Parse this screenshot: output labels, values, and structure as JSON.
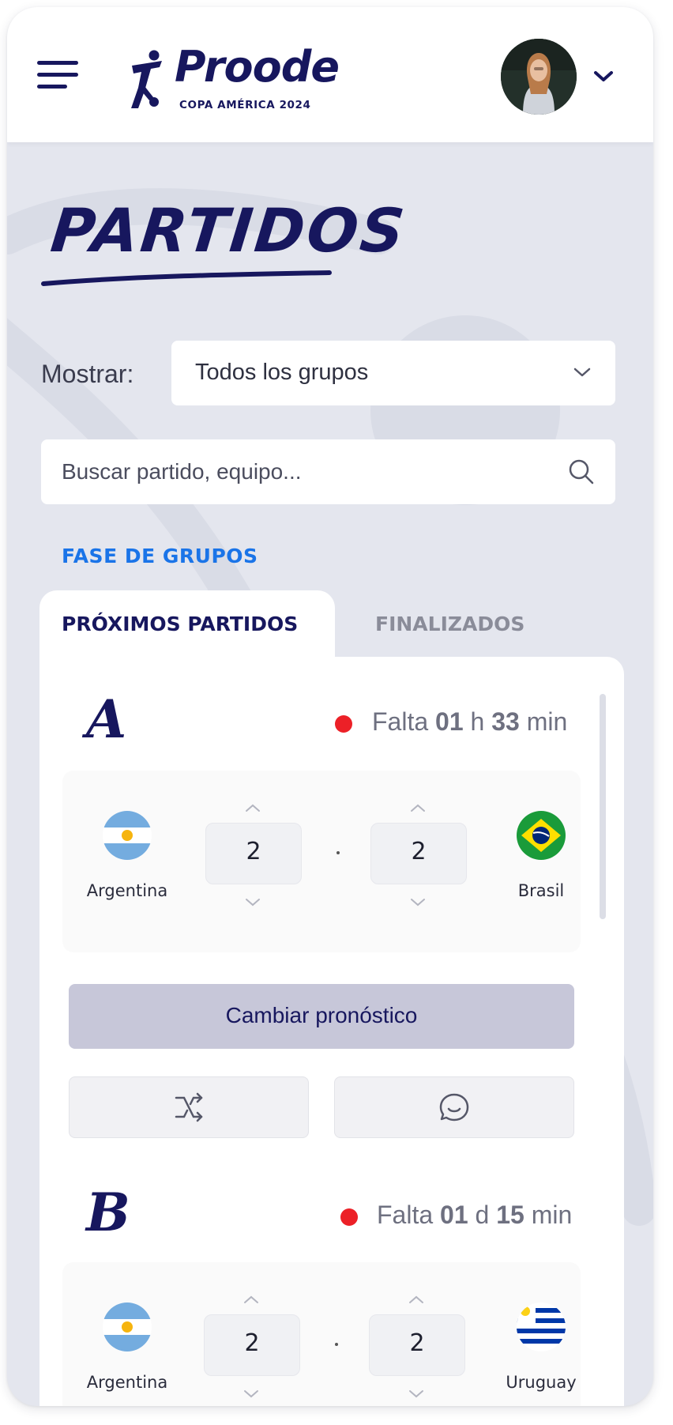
{
  "header": {
    "brand_name": "Proode",
    "brand_subtitle": "COPA AMÉRICA 2024"
  },
  "page": {
    "title": "PARTIDOS"
  },
  "filter": {
    "label": "Mostrar:",
    "selected": "Todos los grupos"
  },
  "search": {
    "placeholder": "Buscar partido, equipo..."
  },
  "phase": {
    "label": "FASE DE GRUPOS"
  },
  "tabs": [
    {
      "label": "PRÓXIMOS PARTIDOS",
      "active": true
    },
    {
      "label": "FINALIZADOS",
      "active": false
    }
  ],
  "matches": [
    {
      "group": "A",
      "countdown": {
        "prefix": "Falta",
        "v1": "01",
        "u1": "h",
        "v2": "33",
        "u2": "min"
      },
      "home": {
        "name": "Argentina",
        "score": "2",
        "flag": "argentina"
      },
      "away": {
        "name": "Brasil",
        "score": "2",
        "flag": "brazil"
      }
    },
    {
      "group": "B",
      "countdown": {
        "prefix": "Falta",
        "v1": "01",
        "u1": "d",
        "v2": "15",
        "u2": "min"
      },
      "home": {
        "name": "Argentina",
        "score": "2",
        "flag": "argentina"
      },
      "away": {
        "name": "Uruguay",
        "score": "2",
        "flag": "uruguay"
      }
    }
  ],
  "actions": {
    "change_prediction": "Cambiar pronóstico",
    "random_icon": "shuffle-icon",
    "comment_icon": "chat-icon"
  },
  "colors": {
    "brand_navy": "#17175e",
    "link_blue": "#1a74e8",
    "live_red": "#ec2027",
    "background": "#e4e6ee",
    "button_muted": "#c7c7d9"
  }
}
